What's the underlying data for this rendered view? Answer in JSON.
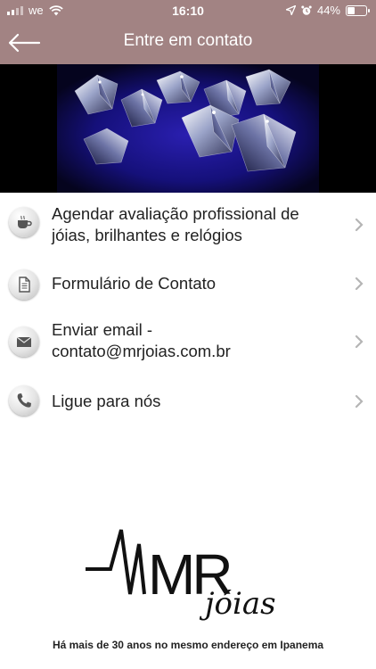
{
  "status_bar": {
    "carrier": "we",
    "time": "16:10",
    "battery": "44%",
    "battery_level": 0.44
  },
  "nav": {
    "title": "Entre em contato"
  },
  "menu": {
    "items": [
      {
        "label_line1": "Agendar avaliação profissional de",
        "label_line2": "jóias, brilhantes e relógios",
        "icon": "coffee-cup-icon"
      },
      {
        "label_line1": "Formulário de Contato",
        "label_line2": "",
        "icon": "document-icon"
      },
      {
        "label_line1": "Enviar email -",
        "label_line2": "contato@mrjoias.com.br",
        "icon": "envelope-icon"
      },
      {
        "label_line1": "Ligue para nós",
        "label_line2": "",
        "icon": "phone-icon"
      }
    ]
  },
  "footer": {
    "logo_main": "MR",
    "logo_script": "jóias",
    "tagline": "Há mais de 30 anos no mesmo endereço em Ipanema"
  },
  "colors": {
    "header": "#a28383",
    "banner_background": "#000000",
    "text": "#222222",
    "chevron": "#b5b5b5"
  }
}
